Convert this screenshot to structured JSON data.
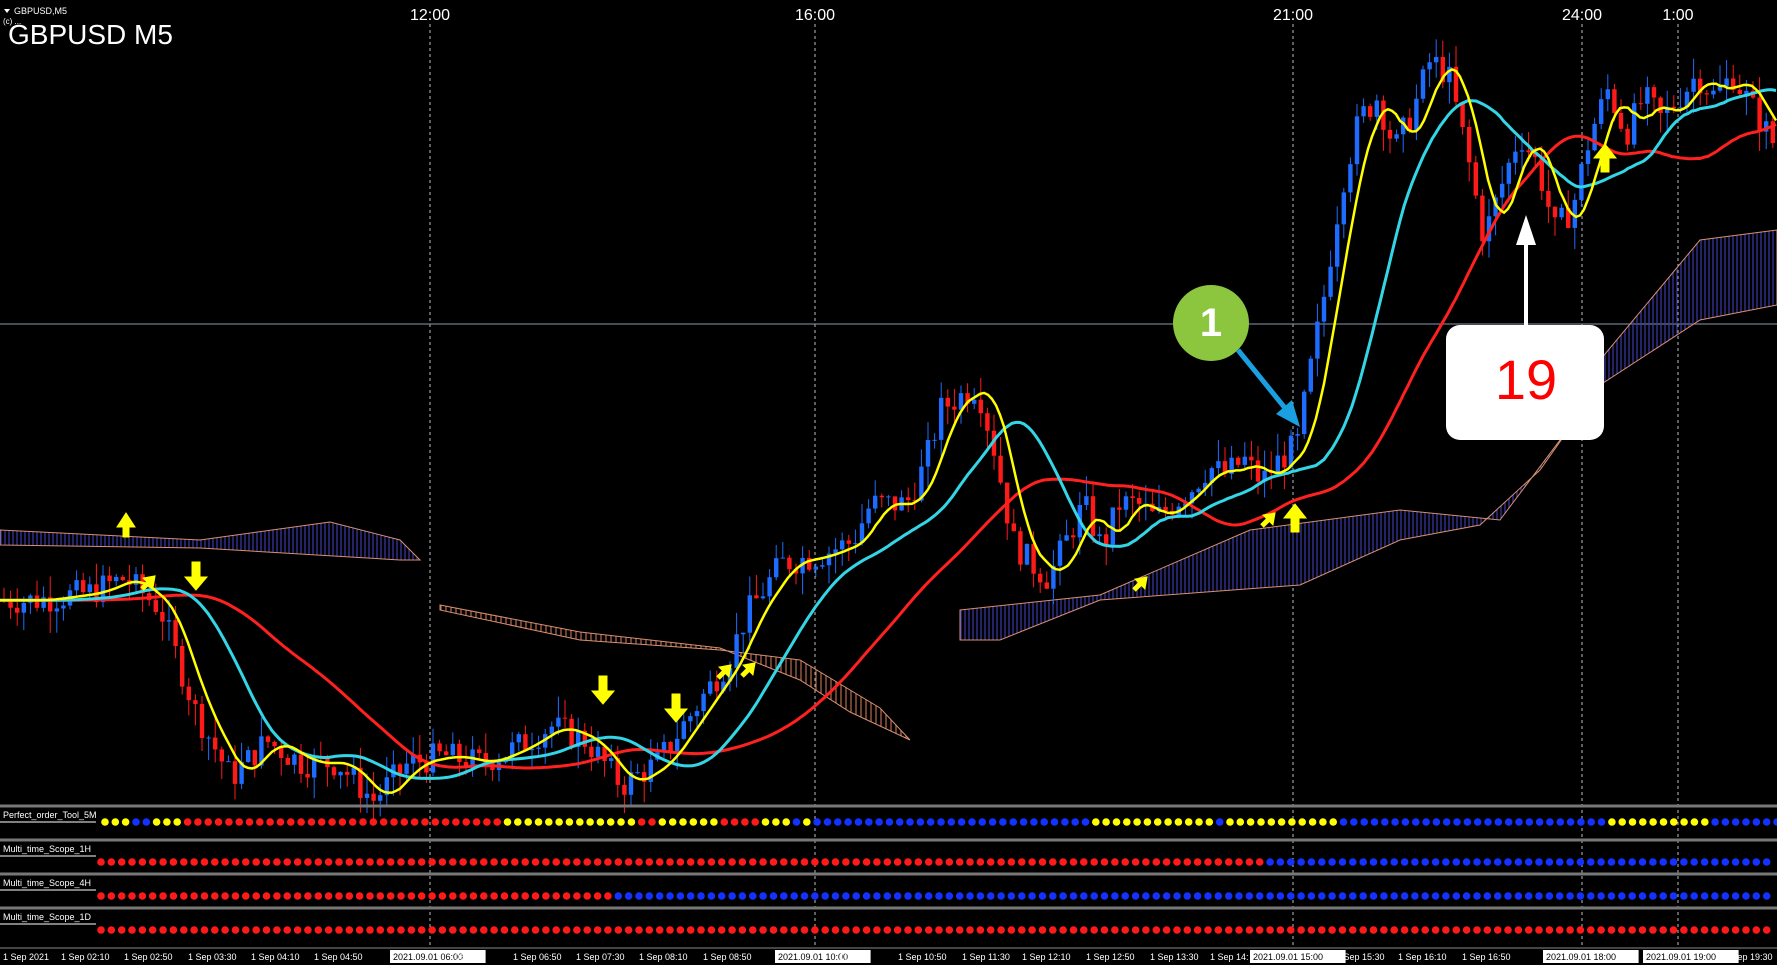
{
  "window": {
    "symbol_tab": "GBPUSD,M5",
    "copyright_line": "(c) ...",
    "chart_title": "GBPUSD M5"
  },
  "colors": {
    "background": "#000000",
    "bull_candle": "#1e6cff",
    "bear_candle": "#ff1a1a",
    "ma_fast": "#ffff00",
    "ma_mid": "#33d6e6",
    "ma_slow": "#ff2020",
    "cloud_bull": "#3a3aa8",
    "cloud_bear": "#d89070",
    "dot_red": "#ff1a1a",
    "dot_blue": "#1432ff",
    "dot_yellow": "#ffff00",
    "arrow_signal": "#ffff00",
    "callout_blue": "#1aa0e0",
    "badge_green": "#8cc63f",
    "callout_red": "#ff0000"
  },
  "top_time_labels": [
    "12:00",
    "16:00",
    "21:00",
    "24:00",
    "1:00"
  ],
  "annotations": {
    "badge_number": "1",
    "callout_number": "19"
  },
  "indicators": [
    {
      "name": "Perfect_order_Tool_5M",
      "dots": [
        [
          "yellow",
          3
        ],
        [
          "blue",
          2
        ],
        [
          "yellow",
          3
        ],
        [
          "red",
          31
        ],
        [
          "yellow",
          13
        ],
        [
          "red",
          2
        ],
        [
          "yellow",
          6
        ],
        [
          "red",
          4
        ],
        [
          "yellow",
          3
        ],
        [
          "blue",
          1
        ],
        [
          "yellow",
          1
        ],
        [
          "blue",
          27
        ],
        [
          "yellow",
          12
        ],
        [
          "blue",
          1
        ],
        [
          "yellow",
          11
        ],
        [
          "blue",
          26
        ],
        [
          "yellow",
          10
        ],
        [
          "blue",
          16
        ]
      ]
    },
    {
      "name": "Multi_time_Scope_1H",
      "dots": [
        [
          "red",
          113
        ],
        [
          "blue",
          49
        ]
      ]
    },
    {
      "name": "Multi_time_Scope_4H",
      "dots": [
        [
          "red",
          50
        ],
        [
          "blue",
          112
        ]
      ]
    },
    {
      "name": "Multi_time_Scope_1D",
      "dots": [
        [
          "red",
          162
        ]
      ]
    }
  ],
  "bottom_time_labels": [
    {
      "text": "1 Sep 2021",
      "boxed": false
    },
    {
      "text": "1 Sep 02:10",
      "boxed": false
    },
    {
      "text": "1 Sep 02:50",
      "boxed": false
    },
    {
      "text": "1 Sep 03:30",
      "boxed": false
    },
    {
      "text": "1 Sep 04:10",
      "boxed": false
    },
    {
      "text": "1 Sep 04:50",
      "boxed": false
    },
    {
      "text": "2021.09.01 06:00",
      "boxed": true
    },
    {
      "text": "06:10",
      "boxed": false
    },
    {
      "text": "1 Sep 06:50",
      "boxed": false
    },
    {
      "text": "1 Sep 07:30",
      "boxed": false
    },
    {
      "text": "1 Sep 08:10",
      "boxed": false
    },
    {
      "text": "1 Sep 08:50",
      "boxed": false
    },
    {
      "text": "2021.09.01 10:00",
      "boxed": true
    },
    {
      "text": "10:10",
      "boxed": false
    },
    {
      "text": "1 Sep 10:50",
      "boxed": false
    },
    {
      "text": "1 Sep 11:30",
      "boxed": false
    },
    {
      "text": "1 Sep 12:10",
      "boxed": false
    },
    {
      "text": "1 Sep 12:50",
      "boxed": false
    },
    {
      "text": "1 Sep 13:30",
      "boxed": false
    },
    {
      "text": "1 Sep 14:",
      "boxed": false
    },
    {
      "text": "2021.09.01 15:00",
      "boxed": true
    },
    {
      "text": "1 Sep 15:30",
      "boxed": false
    },
    {
      "text": "1 Sep 16:10",
      "boxed": false
    },
    {
      "text": "1 Sep 16:50",
      "boxed": false
    },
    {
      "text": "2021.09.01 18:00",
      "boxed": true
    },
    {
      "text": "2021.09.01 19:00",
      "boxed": true
    },
    {
      "text": "1 Sep 19:30",
      "boxed": false
    }
  ],
  "chart_data": {
    "type": "candlestick",
    "instrument": "GBPUSD",
    "timeframe": "M5",
    "close_path_norm": [
      [
        0,
        0.27
      ],
      [
        0.02,
        0.27
      ],
      [
        0.05,
        0.28
      ],
      [
        0.07,
        0.3
      ],
      [
        0.09,
        0.26
      ],
      [
        0.11,
        0.12
      ],
      [
        0.13,
        0.03
      ],
      [
        0.15,
        0.08
      ],
      [
        0.17,
        0.05
      ],
      [
        0.19,
        0.05
      ],
      [
        0.21,
        0.0
      ],
      [
        0.23,
        0.05
      ],
      [
        0.25,
        0.06
      ],
      [
        0.27,
        0.05
      ],
      [
        0.29,
        0.07
      ],
      [
        0.31,
        0.1
      ],
      [
        0.33,
        0.08
      ],
      [
        0.35,
        0.02
      ],
      [
        0.37,
        0.05
      ],
      [
        0.39,
        0.12
      ],
      [
        0.41,
        0.19
      ],
      [
        0.42,
        0.25
      ],
      [
        0.44,
        0.32
      ],
      [
        0.46,
        0.33
      ],
      [
        0.48,
        0.35
      ],
      [
        0.49,
        0.4
      ],
      [
        0.51,
        0.4
      ],
      [
        0.52,
        0.45
      ],
      [
        0.53,
        0.53
      ],
      [
        0.55,
        0.56
      ],
      [
        0.56,
        0.47
      ],
      [
        0.57,
        0.35
      ],
      [
        0.58,
        0.32
      ],
      [
        0.59,
        0.3
      ],
      [
        0.6,
        0.35
      ],
      [
        0.61,
        0.4
      ],
      [
        0.62,
        0.34
      ],
      [
        0.63,
        0.4
      ],
      [
        0.64,
        0.4
      ],
      [
        0.65,
        0.38
      ],
      [
        0.66,
        0.4
      ],
      [
        0.67,
        0.42
      ],
      [
        0.68,
        0.45
      ],
      [
        0.69,
        0.44
      ],
      [
        0.7,
        0.46
      ],
      [
        0.71,
        0.43
      ],
      [
        0.72,
        0.46
      ],
      [
        0.73,
        0.48
      ],
      [
        0.735,
        0.55
      ],
      [
        0.745,
        0.68
      ],
      [
        0.755,
        0.83
      ],
      [
        0.765,
        0.92
      ],
      [
        0.775,
        0.95
      ],
      [
        0.785,
        0.88
      ],
      [
        0.795,
        0.93
      ],
      [
        0.805,
        1.0
      ],
      [
        0.815,
        0.98
      ],
      [
        0.825,
        0.88
      ],
      [
        0.835,
        0.76
      ],
      [
        0.845,
        0.83
      ],
      [
        0.855,
        0.9
      ],
      [
        0.865,
        0.86
      ],
      [
        0.875,
        0.77
      ],
      [
        0.885,
        0.8
      ],
      [
        0.895,
        0.9
      ],
      [
        0.905,
        0.96
      ],
      [
        0.915,
        0.9
      ],
      [
        0.925,
        0.95
      ],
      [
        0.935,
        0.92
      ],
      [
        0.945,
        0.95
      ],
      [
        0.955,
        0.98
      ],
      [
        0.965,
        0.95
      ],
      [
        0.975,
        0.98
      ],
      [
        0.985,
        0.94
      ],
      [
        1.0,
        0.88
      ]
    ]
  }
}
